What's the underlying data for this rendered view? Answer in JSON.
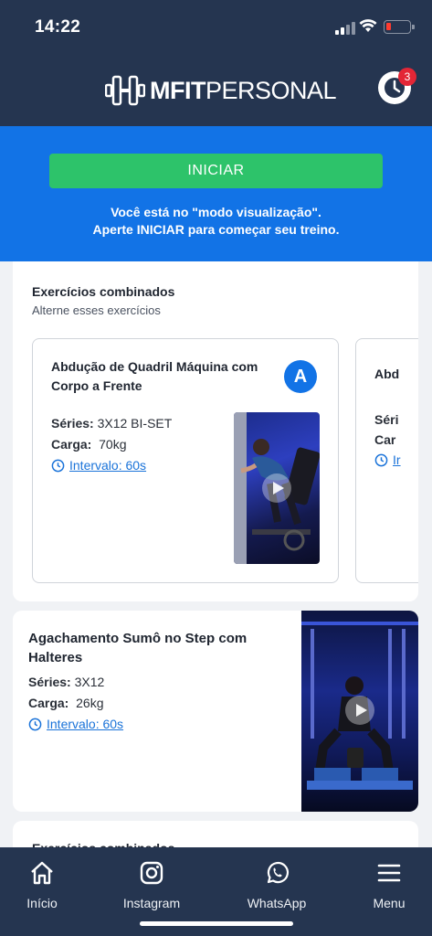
{
  "status_bar": {
    "time": "14:22",
    "battery_level": 0.12
  },
  "header": {
    "logo_bold": "MFIT",
    "logo_regular": "PERSONAL",
    "notification_count": "3"
  },
  "banner": {
    "start_label": "INICIAR",
    "message_line1": "Você está no \"modo visualização\".",
    "message_line2": "Aperte INICIAR para começar seu treino."
  },
  "combined_group": {
    "title": "Exercícios combinados",
    "subtitle": "Alterne esses exercícios",
    "exercises": [
      {
        "name_line1": "Abdução de Quadril Máquina com",
        "name_line2": "Corpo a Frente",
        "letter": "A",
        "series_label": "Séries:",
        "series_value": "3X12 BI-SET",
        "load_label": "Carga:",
        "load_value": "70kg",
        "interval": "Intervalo: 60s"
      },
      {
        "name_partial": "Abd",
        "series_partial": "Séri",
        "load_partial": "Car",
        "interval_partial": "Ir"
      }
    ]
  },
  "single_exercise": {
    "name_line1": "Agachamento Sumô no Step com",
    "name_line2": "Halteres",
    "series_label": "Séries:",
    "series_value": "3X12",
    "load_label": "Carga:",
    "load_value": "26kg",
    "interval": "Intervalo: 60s"
  },
  "next_group_peek": {
    "title": "Exercícios combinados"
  },
  "bottom_nav": [
    {
      "label": "Início",
      "icon": "home-icon"
    },
    {
      "label": "Instagram",
      "icon": "instagram-icon"
    },
    {
      "label": "WhatsApp",
      "icon": "whatsapp-icon"
    },
    {
      "label": "Menu",
      "icon": "menu-icon"
    }
  ],
  "colors": {
    "header_bg": "#253550",
    "banner_bg": "#1273e6",
    "start_button": "#2dc36a",
    "link": "#1a73d9",
    "badge": "#e32636"
  }
}
